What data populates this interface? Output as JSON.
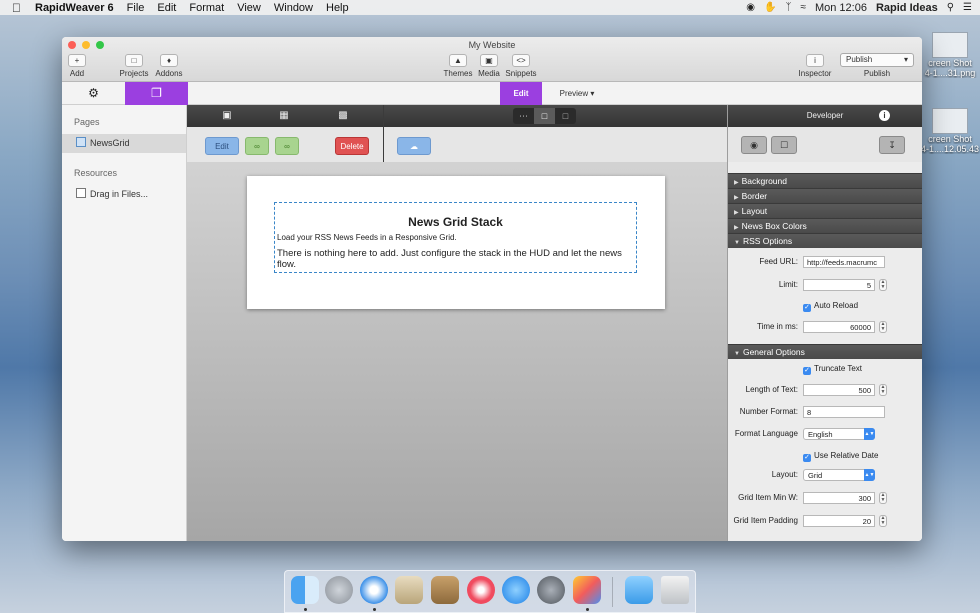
{
  "menubar": {
    "apple": "",
    "app_name": "RapidWeaver 6",
    "menus": [
      "File",
      "Edit",
      "Format",
      "View",
      "Window",
      "Help"
    ],
    "clock": "Mon 12:06",
    "user": "Rapid Ideas"
  },
  "desktop": {
    "items": [
      {
        "label": "creen Shot",
        "label2": "4-1....31.png"
      },
      {
        "label": "creen Shot",
        "label2": "4-1....12.05.43"
      }
    ]
  },
  "window": {
    "title": "My Website",
    "toolbar": {
      "add": "Add",
      "projects": "Projects",
      "addons": "Addons",
      "themes": "Themes",
      "media": "Media",
      "snippets": "Snippets",
      "inspector": "Inspector",
      "publish_pill": "Publish",
      "publish": "Publish"
    },
    "mode_tabs": {
      "edit": "Edit",
      "preview": "Preview"
    },
    "sidebar": {
      "pages_heading": "Pages",
      "page_item": "NewsGrid",
      "resources_heading": "Resources",
      "resource_item": "Drag in Files..."
    },
    "stack_buttons": {
      "edit": "Edit",
      "delete": "Delete"
    },
    "content": {
      "heading": "News Grid Stack",
      "subheading": "Load your RSS News Feeds in a Responsive Grid.",
      "message": "There is nothing here to add. Just configure the stack in the HUD and let the news flow."
    }
  },
  "inspector": {
    "title": "Developer",
    "sections": {
      "background": "Background",
      "border": "Border",
      "layout": "Layout",
      "news_box_colors": "News Box Colors",
      "rss_options": "RSS Options",
      "general_options": "General Options"
    },
    "rss": {
      "feed_url_label": "Feed URL:",
      "feed_url_value": "http://feeds.macrumc",
      "limit_label": "Limit:",
      "limit_value": "5",
      "auto_reload_label": "Auto Reload",
      "time_label": "Time in ms:",
      "time_value": "60000"
    },
    "general": {
      "truncate_label": "Truncate Text",
      "length_label": "Length of Text:",
      "length_value": "500",
      "number_format_label": "Number Format:",
      "number_format_value": "8",
      "format_language_label": "Format Language",
      "format_language_value": "English",
      "relative_date_label": "Use Relative Date",
      "layout_label": "Layout:",
      "layout_value": "Grid",
      "min_w_label": "Grid Item Min W:",
      "min_w_value": "300",
      "padding_label": "Grid Item Padding",
      "padding_value": "20"
    }
  },
  "colors": {
    "accent": "#9b3fe0",
    "checkbox_blue": "#3a8af0",
    "delete_red": "#e05252"
  }
}
